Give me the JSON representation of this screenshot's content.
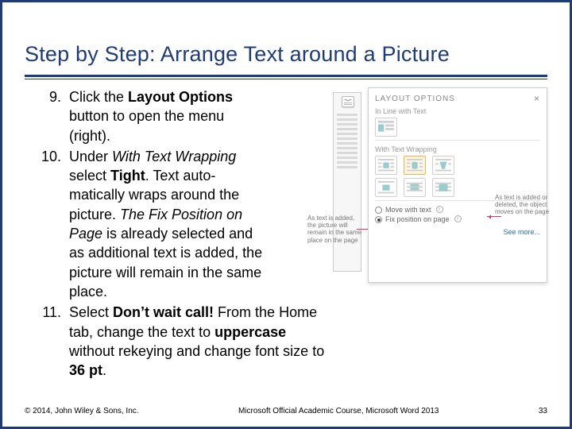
{
  "title": "Step by Step: Arrange Text around a Picture",
  "steps": [
    {
      "n": "9.",
      "html": "Click the <b>Layout Options</b> button to open the menu (right).",
      "narrow": true
    },
    {
      "n": "10.",
      "html": "Under <i>With Text Wrapping</i> select <b>Tight</b>. Text auto-matically wraps around the picture. <i>The Fix Position on Page</i> is already selected and as additional text is added, the picture will remain in the same place.",
      "narrow": true
    },
    {
      "n": "11.",
      "html": "Select <b>Don’t wait call!</b> From the Home tab, change the text to <b>uppercase</b> without rekeying and change font size to <b>36 pt</b>.",
      "narrow": false
    }
  ],
  "panel": {
    "title": "LAYOUT OPTIONS",
    "close": "×",
    "section1": "In Line with Text",
    "section2": "With Text Wrapping",
    "radio1": "Move with text",
    "radio2": "Fix position on page",
    "see_more": "See more...",
    "callout_left": "As text is added, the picture will remain in the same place on the page",
    "callout_right": "As text is added or deleted, the object moves on the page"
  },
  "footer": {
    "copyright": "© 2014, John Wiley & Sons, Inc.",
    "course": "Microsoft Official Academic Course, Microsoft Word 2013",
    "page": "33"
  }
}
